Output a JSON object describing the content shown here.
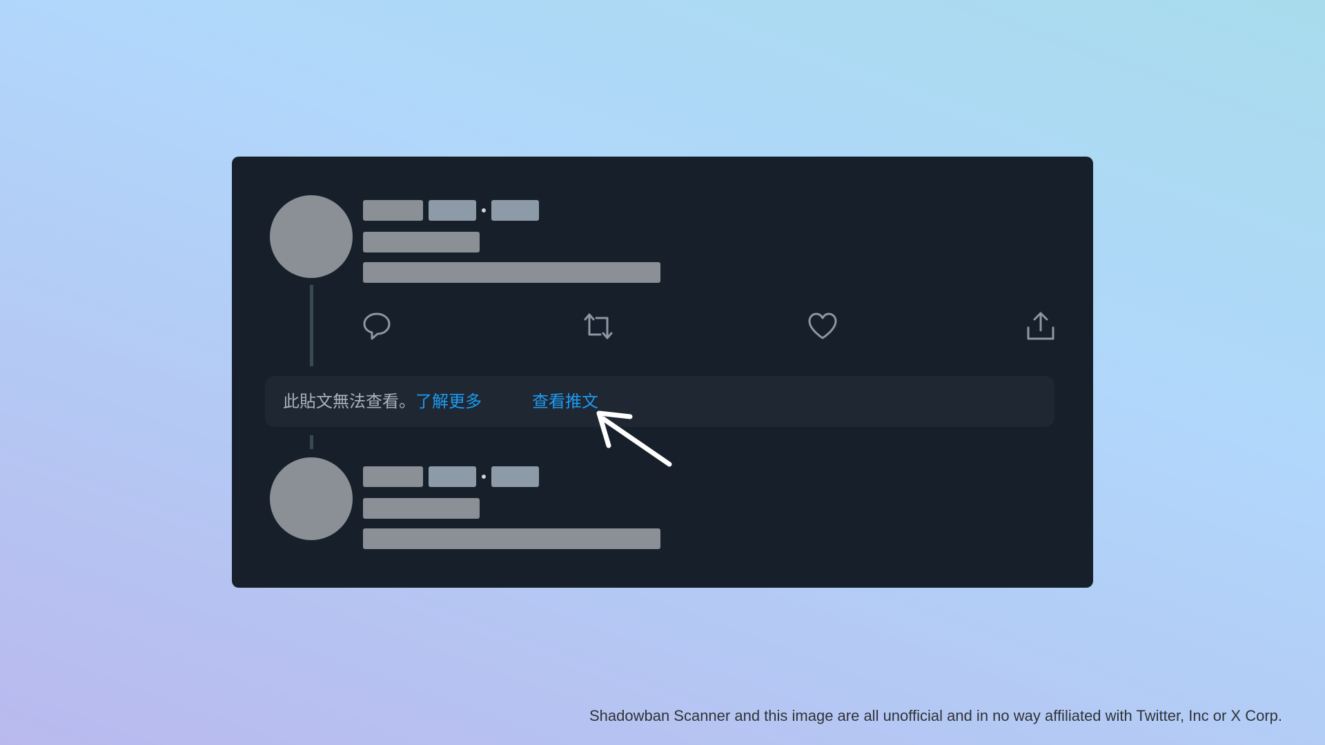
{
  "notice": {
    "message": "此貼文無法查看。",
    "learn_more": "了解更多",
    "view_post": "查看推文"
  },
  "actions": [
    "reply-icon",
    "repost-icon",
    "like-icon",
    "share-icon"
  ],
  "placeholder_note": "Name, handle, timestamp and text rows are grey skeleton blocks with no readable text",
  "disclaimer": "Shadowban Scanner and this image are all unofficial and in no way affiliated with Twitter, Inc or X Corp.",
  "colors": {
    "card": "#17202a",
    "notice_bg": "#1f2733",
    "link": "#1d9bf0",
    "skeleton_grey": "#8b8f96",
    "skeleton_slate": "#8d9ba8",
    "icon": "#8b98a5"
  }
}
